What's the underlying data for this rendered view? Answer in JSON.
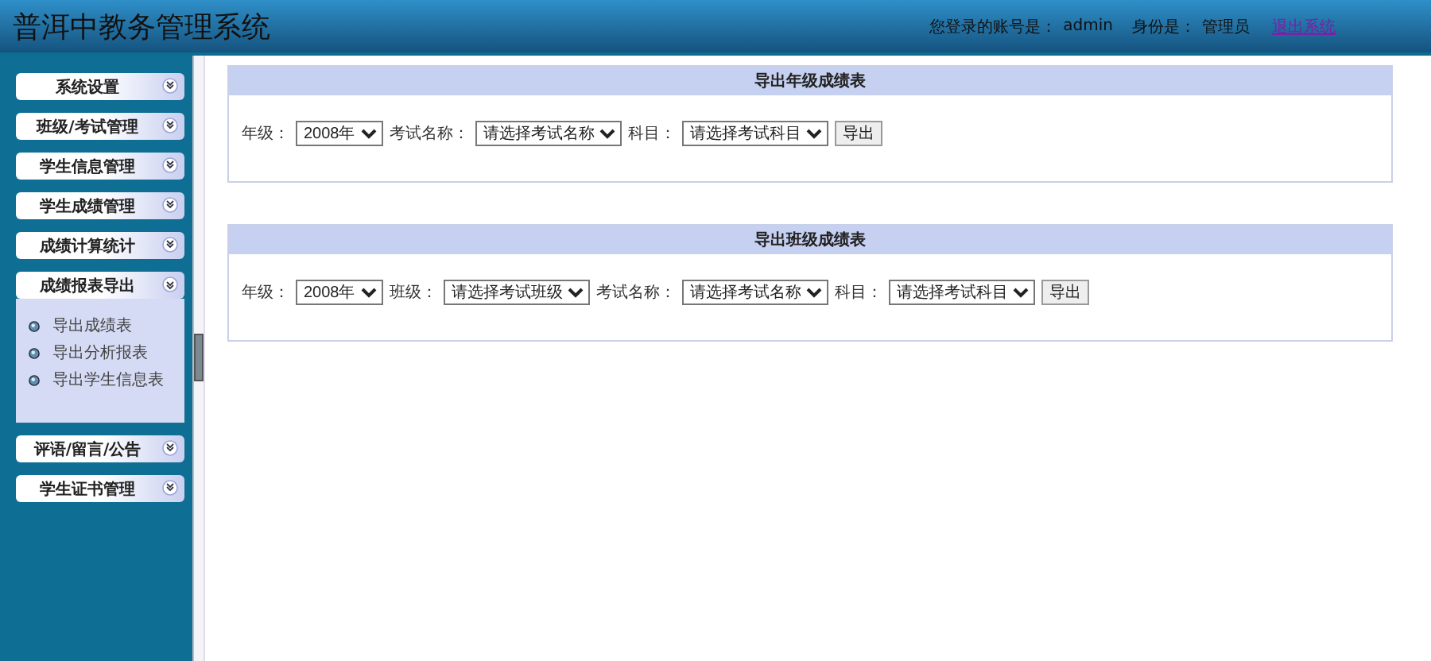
{
  "header": {
    "title": "普洱中教务管理系统",
    "account_label": "您登录的账号是：",
    "account": "admin",
    "role_label": "身份是：",
    "role": "管理员",
    "logout": "退出系统"
  },
  "sidebar": {
    "sections": [
      {
        "label": "系统设置",
        "expanded": false
      },
      {
        "label": "班级/考试管理",
        "expanded": false
      },
      {
        "label": "学生信息管理",
        "expanded": false
      },
      {
        "label": "学生成绩管理",
        "expanded": false
      },
      {
        "label": "成绩计算统计",
        "expanded": false
      },
      {
        "label": "成绩报表导出",
        "expanded": true,
        "children": [
          {
            "label": "导出成绩表"
          },
          {
            "label": "导出分析报表"
          },
          {
            "label": "导出学生信息表"
          }
        ]
      },
      {
        "label": "评语/留言/公告",
        "expanded": false
      },
      {
        "label": "学生证书管理",
        "expanded": false
      }
    ]
  },
  "panels": [
    {
      "title": "导出年级成绩表",
      "fields": [
        {
          "label": "年级：",
          "value": "2008年"
        },
        {
          "label": "考试名称：",
          "value": "请选择考试名称"
        },
        {
          "label": "科目：",
          "value": "请选择考试科目"
        }
      ],
      "button": "导出"
    },
    {
      "title": "导出班级成绩表",
      "fields": [
        {
          "label": "年级：",
          "value": "2008年"
        },
        {
          "label": "班级：",
          "value": "请选择考试班级"
        },
        {
          "label": "考试名称：",
          "value": "请选择考试名称"
        },
        {
          "label": "科目：",
          "value": "请选择考试科目"
        }
      ],
      "button": "导出"
    }
  ]
}
